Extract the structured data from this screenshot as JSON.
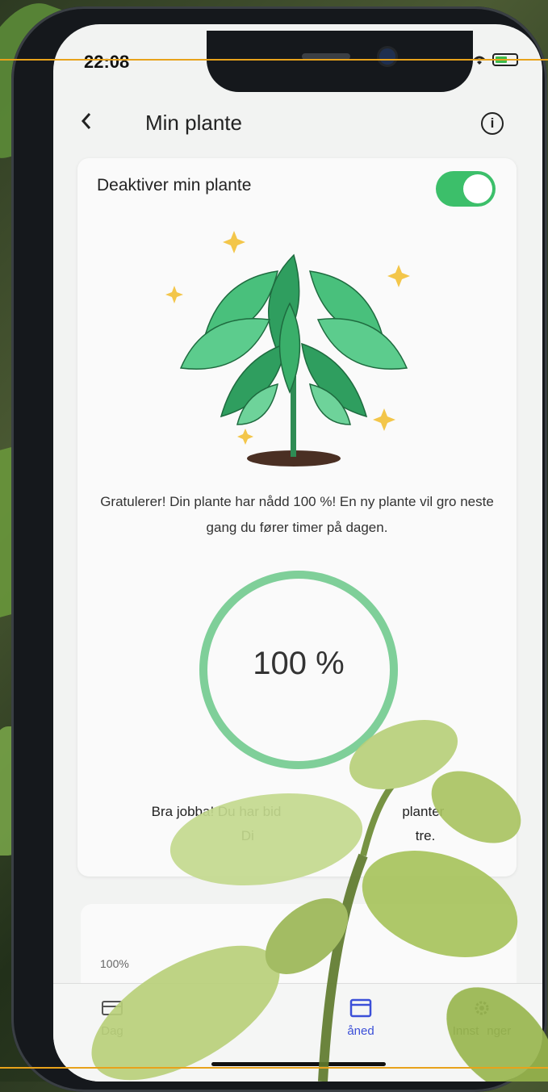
{
  "status_bar": {
    "time": "22:08"
  },
  "header": {
    "back_icon": "chevron-left-icon",
    "title": "Min plante",
    "info_icon": "info-icon"
  },
  "toggle": {
    "label": "Deaktiver min plante",
    "state": "on"
  },
  "plant": {
    "icon": "plant-illustration"
  },
  "message": "Gratulerer! Din plante har nådd 100 %! En ny plante vil gro neste gang du fører timer på dagen.",
  "progress": {
    "value_text": "100 %",
    "fraction": 1.0
  },
  "bottom_message": {
    "line1": "Bra jobba! Du har bid",
    "line1_end": "planter",
    "line2_start": "Di",
    "line2_end": "tre."
  },
  "chart_card": {
    "axis_label": "100%"
  },
  "nav": {
    "items": [
      {
        "label": "Dag",
        "icon": "day-calendar-icon"
      },
      {
        "label": "åned",
        "icon": "month-calendar-icon",
        "active": true
      },
      {
        "label": "Innst",
        "label_end": "nger",
        "icon": "settings-icon"
      }
    ]
  },
  "colors": {
    "accent_green": "#3cbf6a",
    "progress_ring": "#7fcf99",
    "active_nav": "#3b4fd8"
  }
}
